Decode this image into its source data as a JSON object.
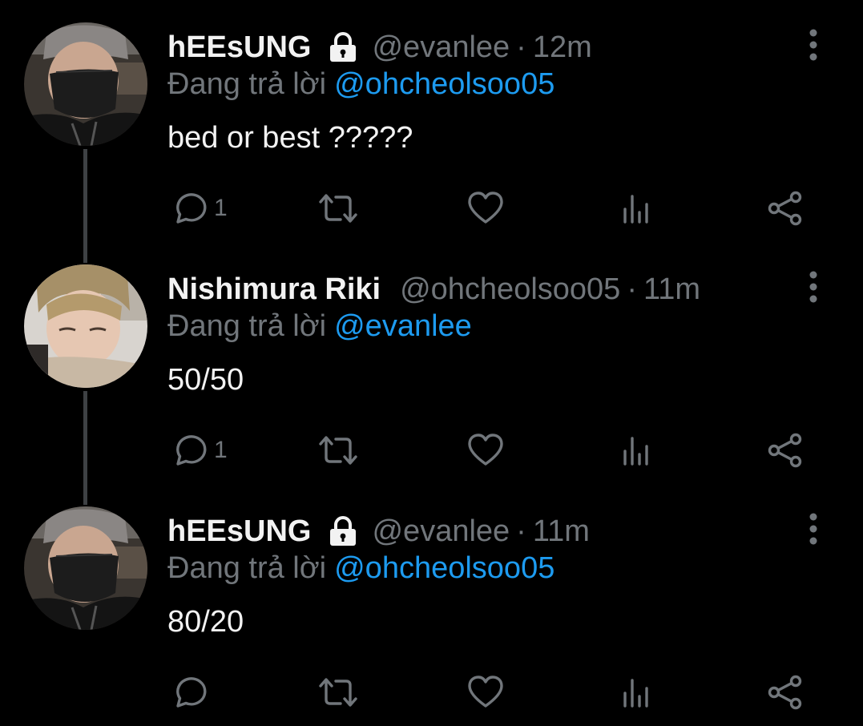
{
  "colors": {
    "background": "#000000",
    "name_text": "#f2f2f2",
    "muted_text": "#71767b",
    "link": "#1d9bf0",
    "thread_line": "#3e4144"
  },
  "tweets": [
    {
      "name": "hEEsUNG",
      "locked": true,
      "handle": "@evanlee",
      "dot": "·",
      "time": "12m",
      "reply_prefix": "Đang trả lời",
      "reply_to": "@ohcheolsoo05",
      "text": "bed or best ?????",
      "reply_count": "1",
      "avatar_icon": "avatar-masked-person"
    },
    {
      "name": "Nishimura Riki",
      "locked": false,
      "handle": "@ohcheolsoo05",
      "dot": "·",
      "time": "11m",
      "reply_prefix": "Đang trả lời",
      "reply_to": "@evanlee",
      "text": "50/50",
      "reply_count": "1",
      "avatar_icon": "avatar-blond-person"
    },
    {
      "name": "hEEsUNG",
      "locked": true,
      "handle": "@evanlee",
      "dot": "·",
      "time": "11m",
      "reply_prefix": "Đang trả lời",
      "reply_to": "@ohcheolsoo05",
      "text": "80/20",
      "reply_count": "",
      "avatar_icon": "avatar-masked-person"
    }
  ],
  "icons": {
    "reply": "reply-bubble-icon",
    "retweet": "retweet-icon",
    "like": "heart-icon",
    "views": "views-bar-icon",
    "share": "share-icon",
    "more": "more-vertical-icon",
    "lock": "lock-icon"
  }
}
